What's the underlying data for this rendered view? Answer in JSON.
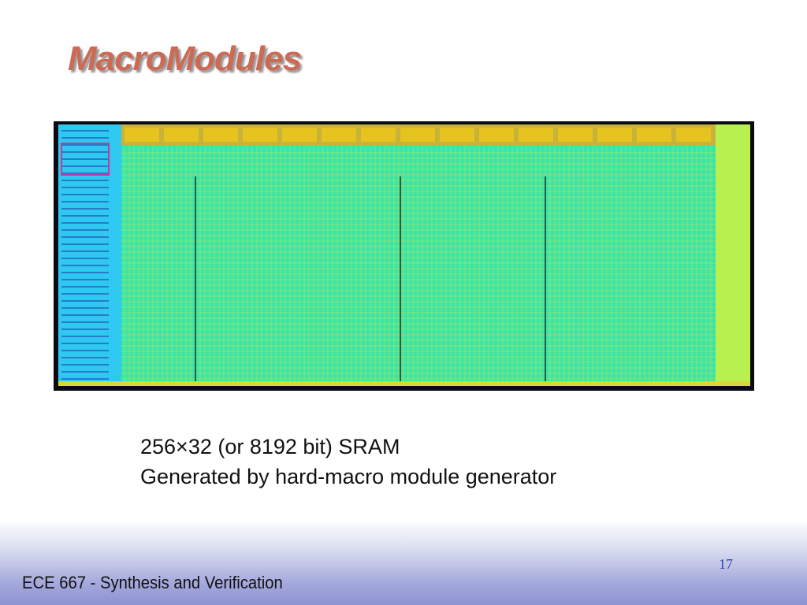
{
  "slide": {
    "title": "MacroModules",
    "caption": {
      "line1": "256×32 (or 8192 bit) SRAM",
      "line2": "Generated by hard-macro module generator"
    },
    "footer": "ECE 667 - Synthesis and Verification",
    "page_number": "17"
  },
  "colors": {
    "title": "#cc6b55",
    "layout_background": "#0a0a12",
    "memory_array": "#38e6a8",
    "header_blocks": "#e6c31e",
    "decoder_column": "#2ec8f0",
    "right_strip": "#b8f050",
    "footer_band": "#8e93d2"
  }
}
